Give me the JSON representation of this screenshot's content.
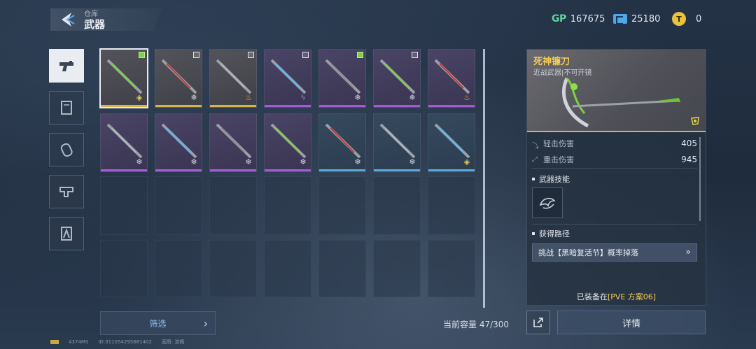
{
  "header": {
    "subtitle": "仓库",
    "title": "武器"
  },
  "currencies": {
    "gp_label": "GP",
    "gp_value": "167675",
    "ticket_value": "25180",
    "coin_value": "0"
  },
  "categories": [
    {
      "icon": "pistol-icon",
      "active": true
    },
    {
      "icon": "scroll-icon",
      "active": false
    },
    {
      "icon": "grenade-icon",
      "active": false
    },
    {
      "icon": "gun-part-icon",
      "active": false
    },
    {
      "icon": "tool-icon",
      "active": false
    }
  ],
  "inventory": {
    "items": [
      {
        "rarity": "gold",
        "checked": true,
        "selected": true,
        "element": "mark"
      },
      {
        "rarity": "gold",
        "checked": false,
        "element": "ice"
      },
      {
        "rarity": "gold",
        "checked": false,
        "element": "fire"
      },
      {
        "rarity": "purple",
        "checked": false,
        "element": "lightning"
      },
      {
        "rarity": "purple",
        "checked": true,
        "element": "ice"
      },
      {
        "rarity": "purple",
        "checked": false,
        "element": "ice"
      },
      {
        "rarity": "purple",
        "checked": null,
        "element": "fire"
      },
      {
        "rarity": "purple",
        "checked": null,
        "element": "ice"
      },
      {
        "rarity": "purple",
        "checked": null,
        "element": "ice"
      },
      {
        "rarity": "purple",
        "checked": null,
        "element": "ice"
      },
      {
        "rarity": "purple",
        "checked": null,
        "element": "ice"
      },
      {
        "rarity": "blue",
        "checked": null,
        "element": "ice"
      },
      {
        "rarity": "blue",
        "checked": null,
        "element": "ice"
      },
      {
        "rarity": "blue",
        "checked": null,
        "element": "mark"
      }
    ],
    "capacity_label": "当前容量 47/300"
  },
  "filter": {
    "label": "筛选"
  },
  "detail": {
    "name": "死神镰刀",
    "type": "近战武器|不可开镜",
    "stats": [
      {
        "label": "轻击伤害",
        "value": "405"
      },
      {
        "label": "重击伤害",
        "value": "945"
      }
    ],
    "skill_section": "武器技能",
    "path_section": "获得路径",
    "path_text": "挑战【黑暗复活节】概率掉落",
    "equipped_prefix": "已装备在",
    "equipped_value": "[PVE 方案06]",
    "detail_button": "详情"
  },
  "footer": {
    "ping": "4374MS",
    "id": "ID:311054295681402",
    "quality": "画质: 流畅"
  }
}
